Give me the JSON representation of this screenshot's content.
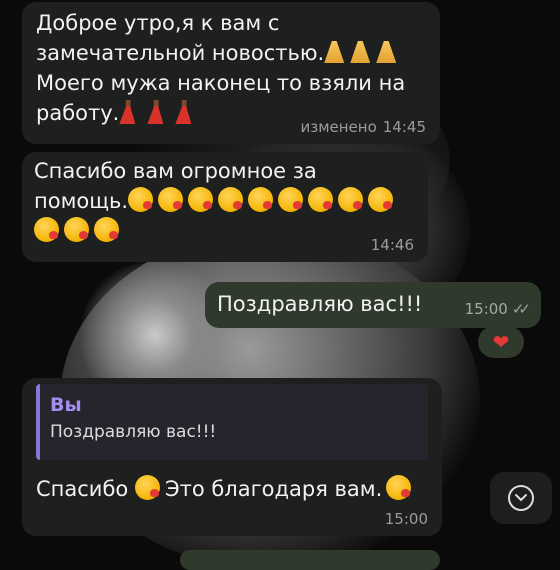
{
  "messages": [
    {
      "id": "m1",
      "direction": "incoming",
      "lines": [
        "Доброе утро,я к вам с",
        "замечательной новостью.",
        "Моего мужа наконец то взяли на",
        "работу."
      ],
      "emoji_1": [
        "pray",
        "pray",
        "pray"
      ],
      "emoji_2": [
        "dancer",
        "dancer",
        "dancer"
      ],
      "edited_label": "изменено",
      "time": "14:45"
    },
    {
      "id": "m2",
      "direction": "incoming",
      "lines": [
        "Спасибо вам огромное за",
        "помощь."
      ],
      "emoji_kiss_count": 12,
      "time": "14:46"
    },
    {
      "id": "m3",
      "direction": "outgoing",
      "text": "Поздравляю вас!!!",
      "time": "15:00",
      "status": "read",
      "reaction": "❤"
    },
    {
      "id": "m4",
      "direction": "incoming",
      "reply_to": {
        "author": "Вы",
        "text": "Поздравляю вас!!!"
      },
      "text_before": "Спасибо ",
      "text_after": "Это благодаря вам.",
      "time": "15:00"
    }
  ],
  "colors": {
    "incoming_bubble": "#1e1f1f",
    "outgoing_bubble": "#2f3a2c",
    "reply_accent": "#8e74d9",
    "reaction_heart": "#e53935"
  },
  "icons": {
    "scroll_down": "chevron-down-icon",
    "read_status": "double-check-icon"
  }
}
